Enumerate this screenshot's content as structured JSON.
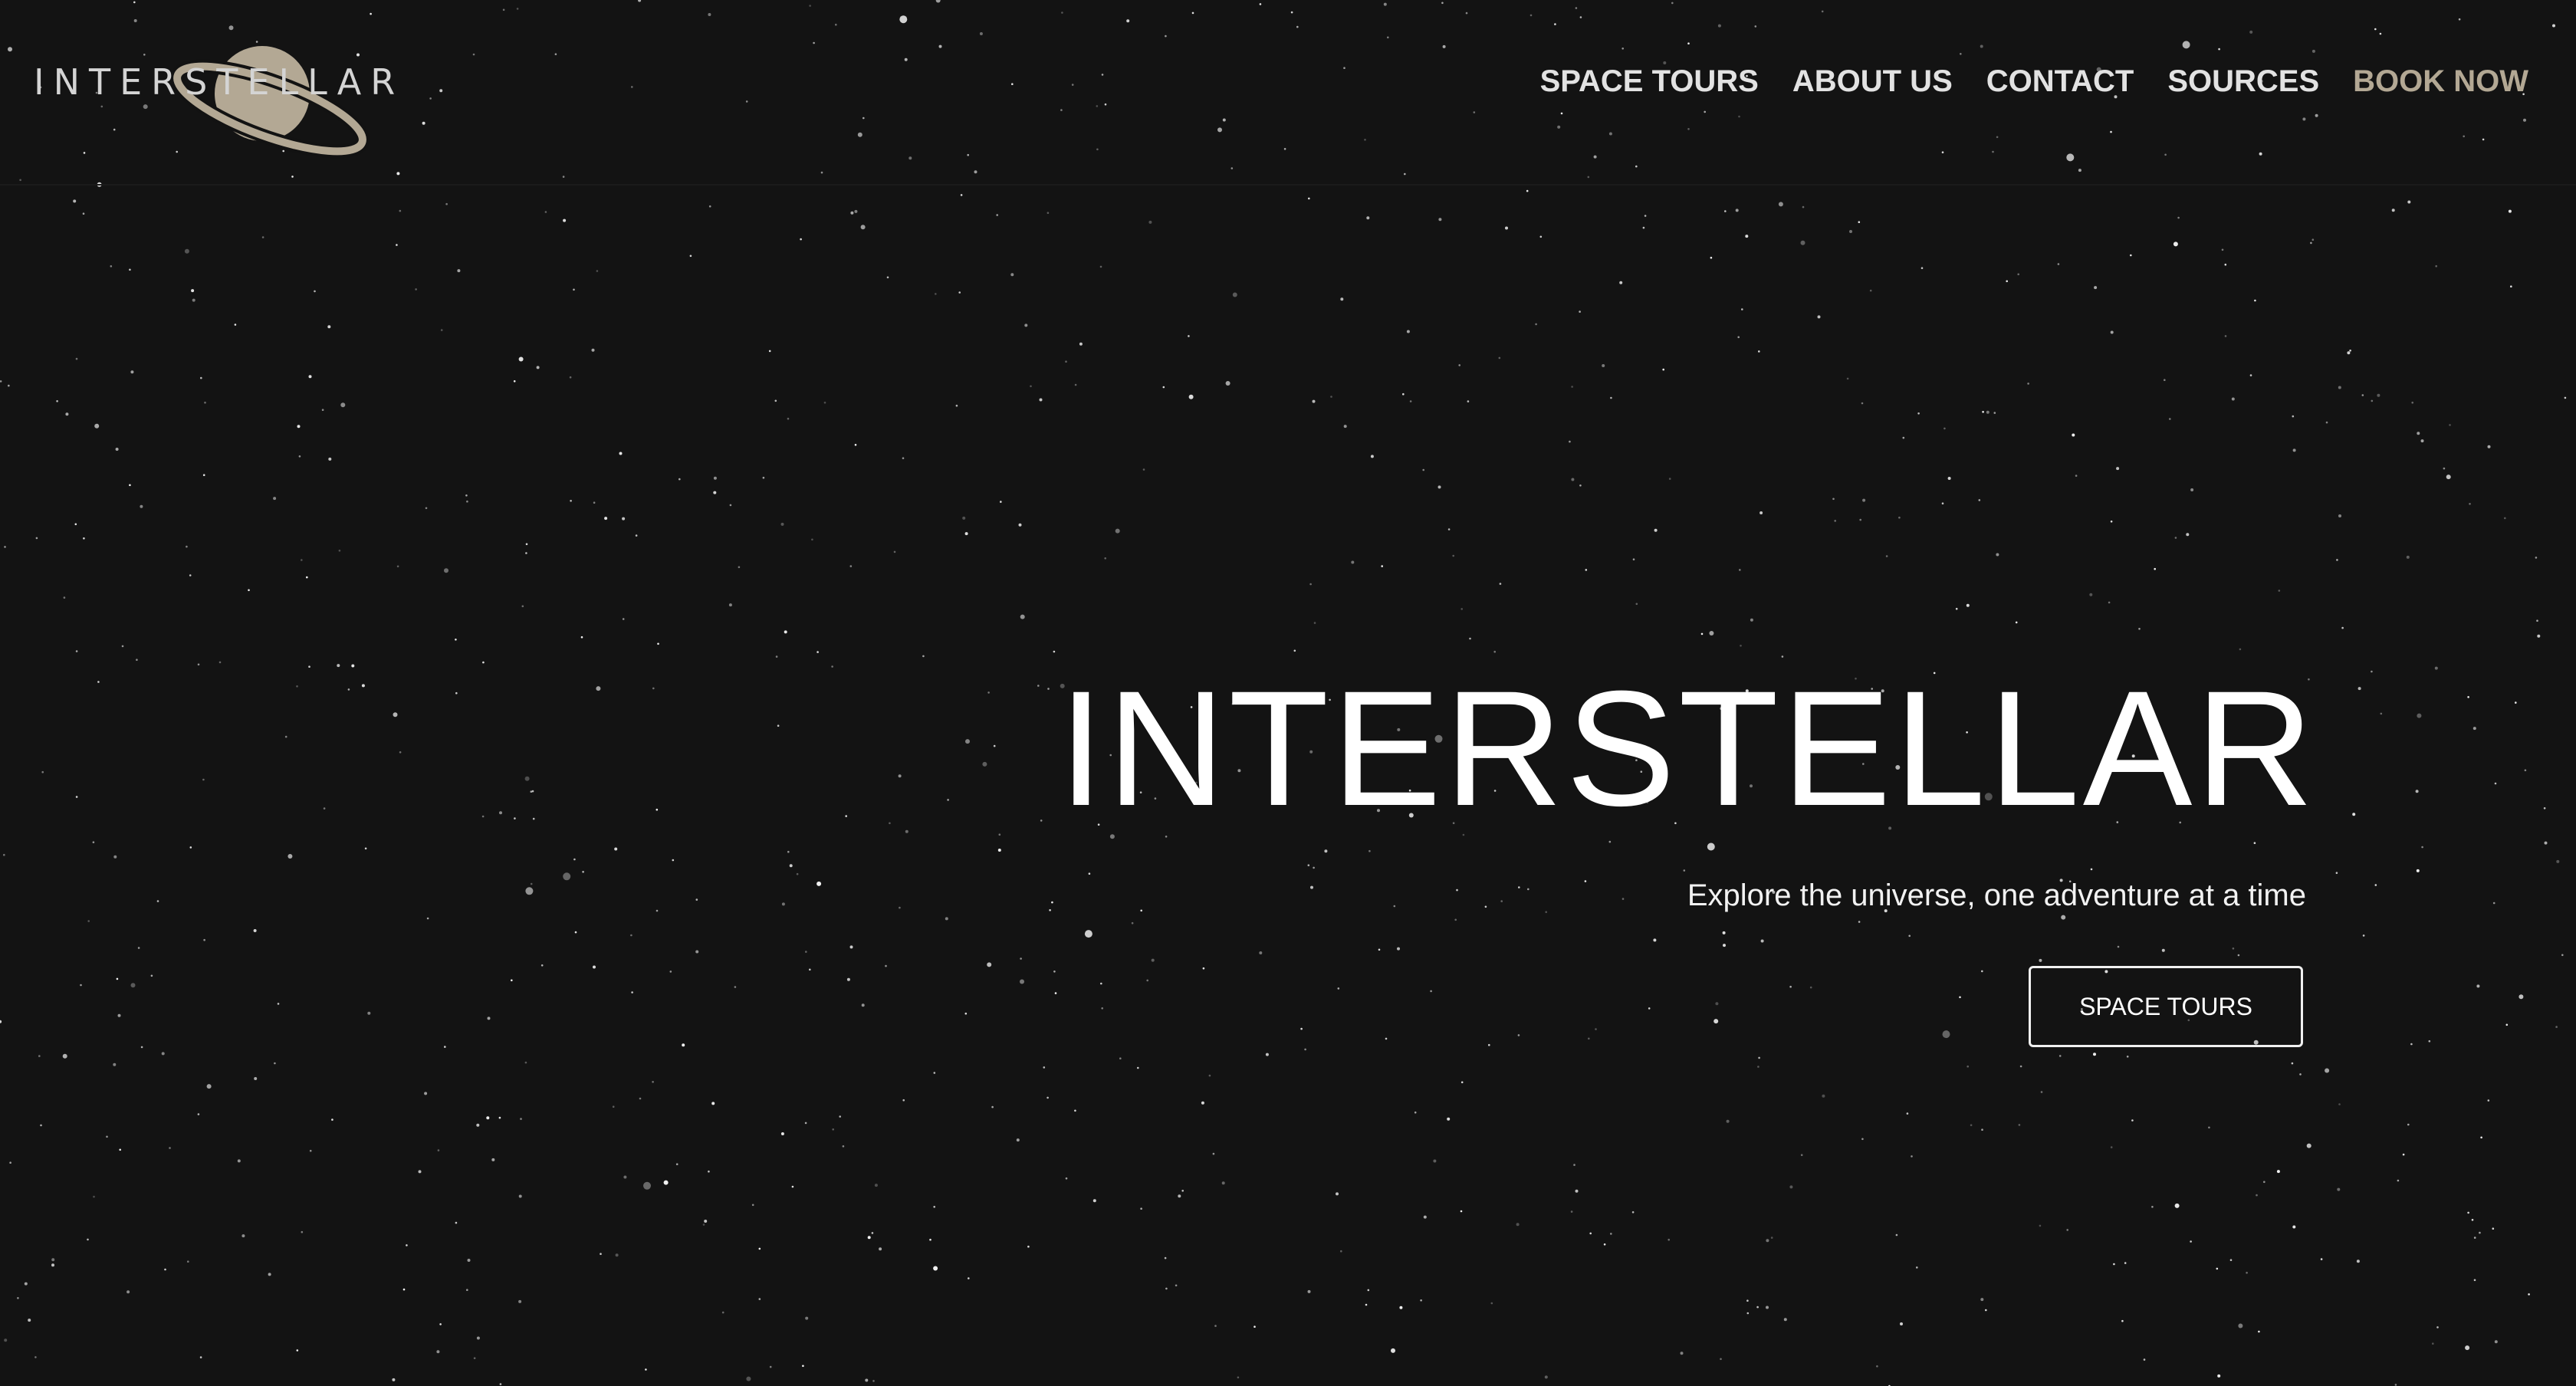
{
  "header": {
    "logo_text": "INTERSTELLAR",
    "logo_icon": "planet-icon",
    "nav": {
      "space_tours": "SPACE TOURS",
      "about_us": "ABOUT US",
      "contact": "CONTACT",
      "sources": "SOURCES",
      "book_now": "BOOK NOW"
    }
  },
  "hero": {
    "title": "INTERSTELLAR",
    "subtitle": "Explore the universe, one adventure at a time",
    "cta_label": "SPACE TOURS"
  },
  "colors": {
    "background": "#131313",
    "accent": "#b3a894",
    "nav_text": "#e2e2e2",
    "text": "#ffffff"
  }
}
